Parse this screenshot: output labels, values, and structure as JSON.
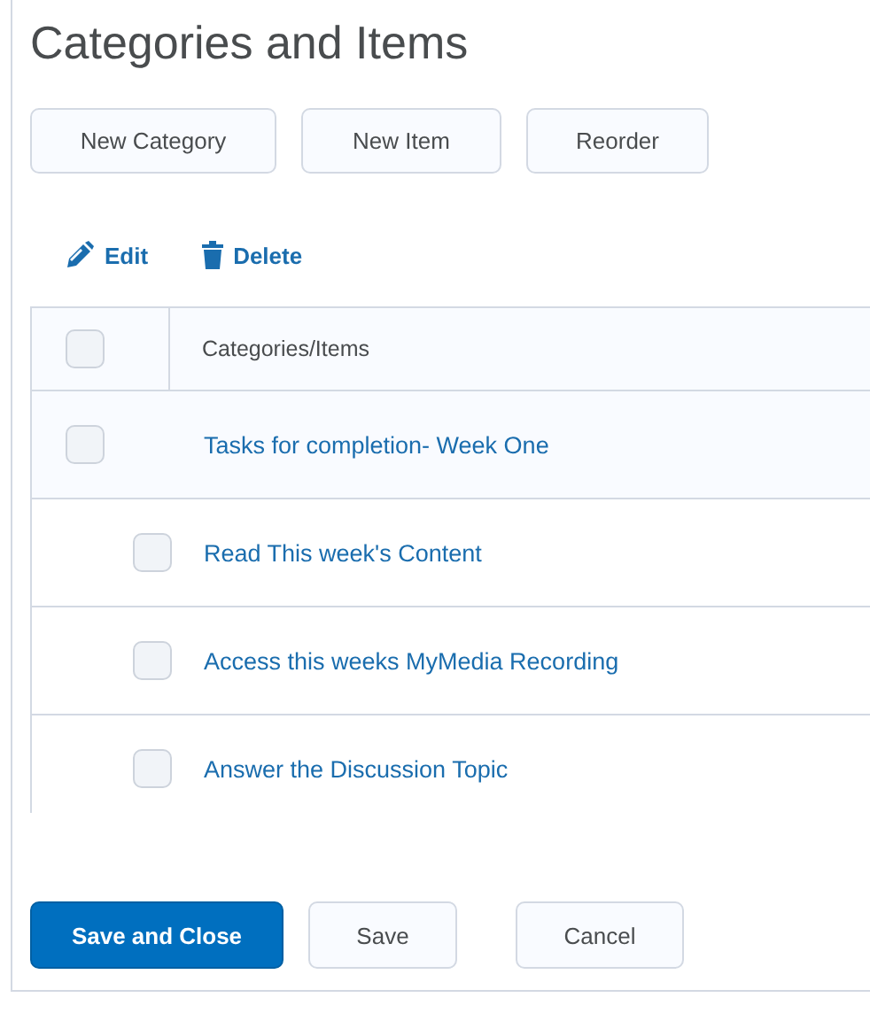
{
  "title": "Categories and Items",
  "toolbar_buttons": [
    "New Category",
    "New Item",
    "Reorder"
  ],
  "actions": [
    {
      "kind": "edit",
      "label": "Edit"
    },
    {
      "kind": "delete",
      "label": "Delete"
    }
  ],
  "table": {
    "header": {
      "label": "Categories/Items",
      "checked": false
    },
    "rows": [
      {
        "label": "Tasks for completion- Week One",
        "checked": false,
        "children": [
          {
            "label": "Read This week's Content",
            "checked": false
          },
          {
            "label": "Access this weeks MyMedia Recording",
            "checked": false
          },
          {
            "label": "Answer the Discussion Topic",
            "checked": false
          }
        ]
      }
    ]
  },
  "footer_buttons": [
    {
      "label": "Save and Close",
      "primary": true
    },
    {
      "label": "Save",
      "primary": false
    },
    {
      "label": "Cancel",
      "primary": false
    }
  ]
}
